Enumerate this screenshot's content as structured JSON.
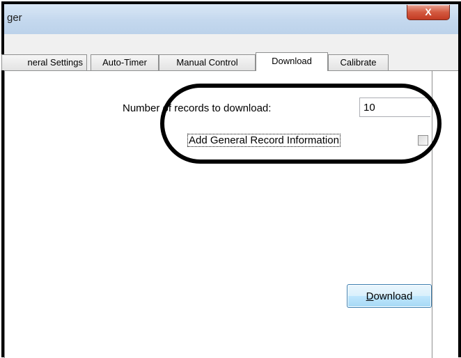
{
  "window": {
    "title": "ger",
    "close_label": "X"
  },
  "tabs": [
    {
      "label": "neral Settings"
    },
    {
      "label": "Auto-Timer"
    },
    {
      "label": "Manual Control"
    },
    {
      "label": "Download",
      "selected": true
    },
    {
      "label": "Calibrate"
    }
  ],
  "download_page": {
    "records_label": "Number of records to download:",
    "records_value": "10",
    "add_info_label": "Add General Record Information",
    "add_info_checked": false,
    "download_button": {
      "mnemonic": "D",
      "rest": "ownload"
    }
  },
  "colors": {
    "annotation_ring": "#000000",
    "button_border": "#3c7fb1"
  }
}
